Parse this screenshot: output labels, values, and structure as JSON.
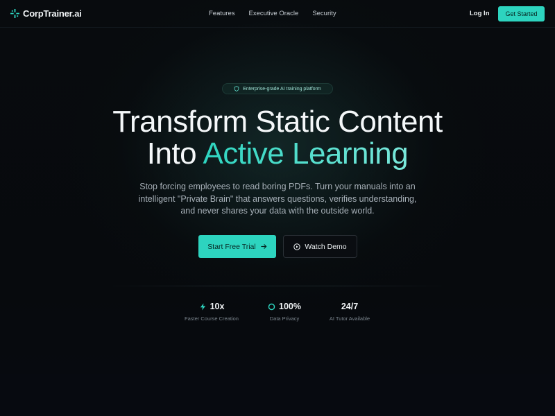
{
  "brand": {
    "name": "CorpTrainer",
    "suffix": ".ai",
    "accent_color": "#2dd4bf",
    "icon": "sparkle-cross-icon"
  },
  "nav": {
    "links": [
      "Features",
      "Executive Oracle",
      "Security"
    ],
    "login_label": "Log In",
    "cta_label": "Get Started"
  },
  "hero": {
    "badge_text": "Enterprise-grade AI training platform",
    "badge_icon": "shield-icon",
    "headline_line1": "Transform Static Content",
    "headline_line2_prefix": "Into ",
    "headline_line2_accent": "Active Learning",
    "subtext": "Stop forcing employees to read boring PDFs. Turn your manuals into an intelligent \"Private Brain\" that answers questions, verifies understanding, and never shares your data with the outside world.",
    "primary_cta": "Start Free Trial",
    "primary_cta_icon": "arrow-right-icon",
    "secondary_cta": "Watch Demo",
    "secondary_cta_icon": "play-circle-icon"
  },
  "stats": [
    {
      "value": "10x",
      "label": "Faster Course Creation",
      "icon": "lightning-icon"
    },
    {
      "value": "100%",
      "label": "Data Privacy",
      "icon": "ring-icon"
    },
    {
      "value": "24/7",
      "label": "AI Tutor Available",
      "icon": ""
    }
  ]
}
